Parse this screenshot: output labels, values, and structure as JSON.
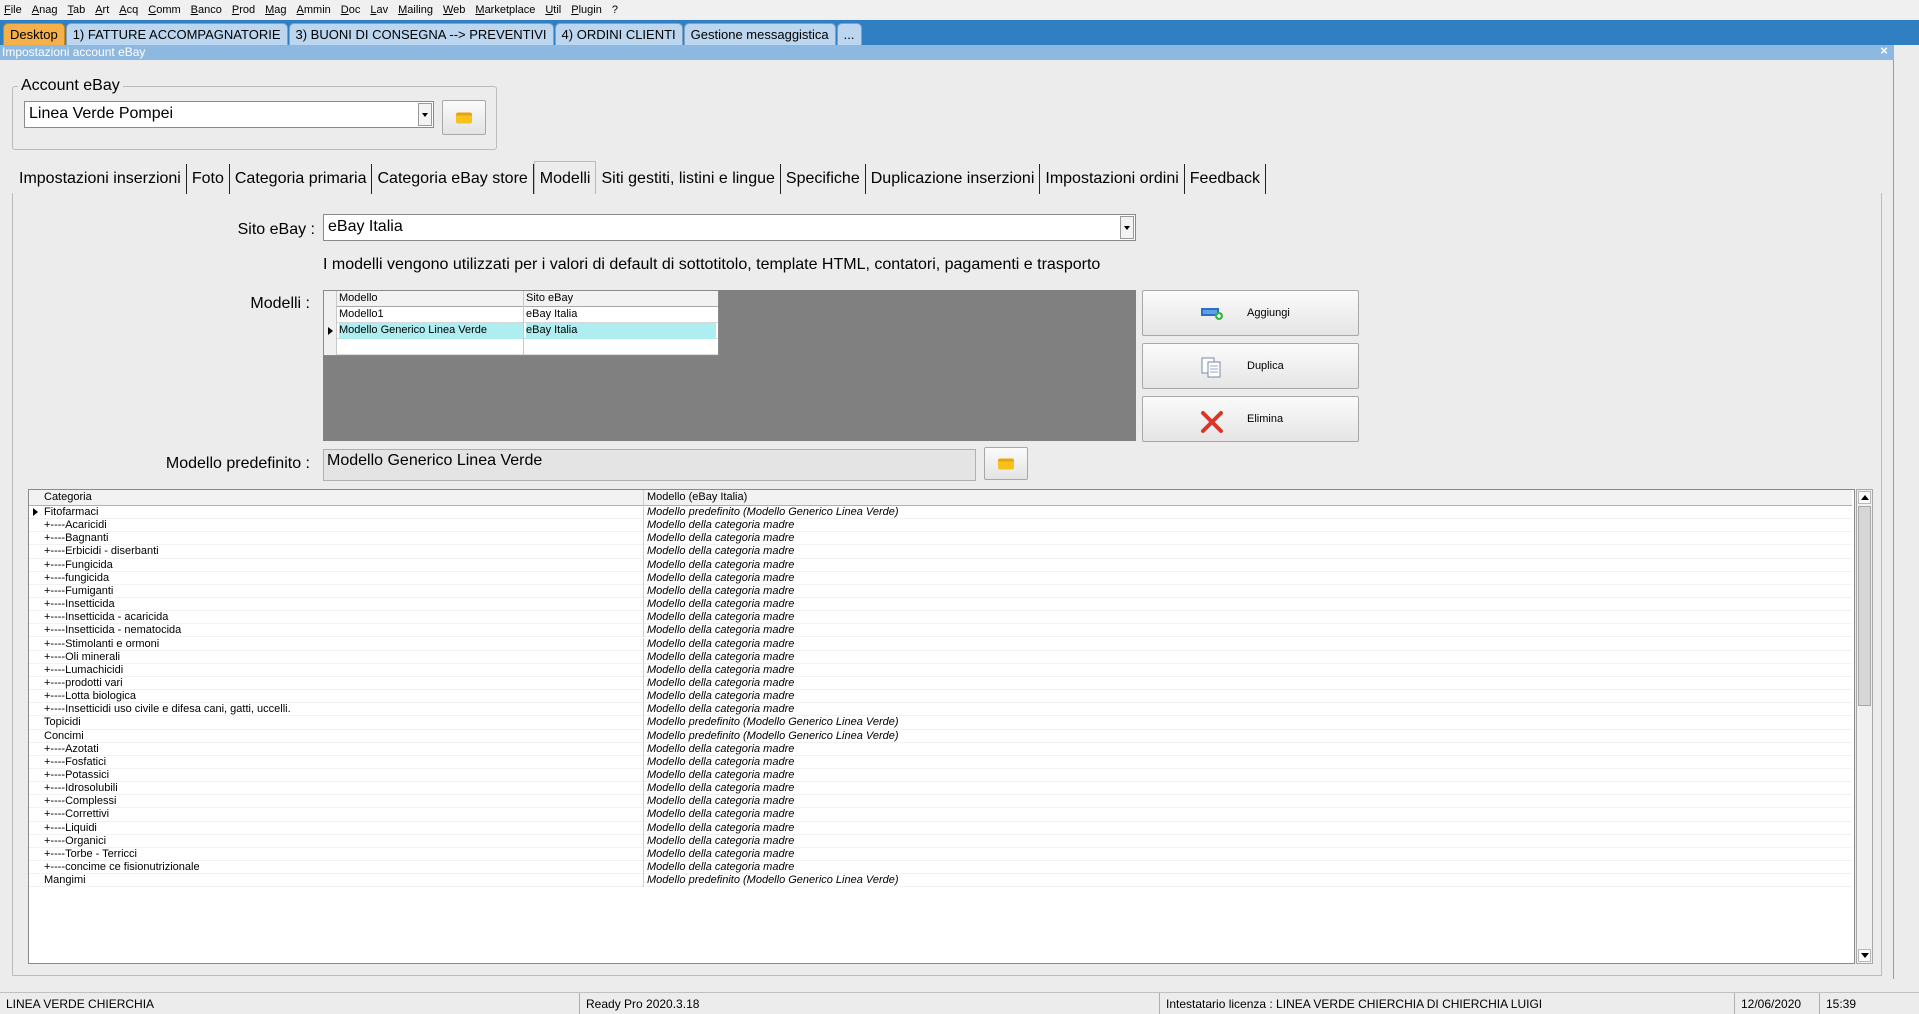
{
  "menu": [
    "File",
    "Anag",
    "Tab",
    "Art",
    "Acq",
    "Comm",
    "Banco",
    "Prod",
    "Mag",
    "Ammin",
    "Doc",
    "Lav",
    "Mailing",
    "Web",
    "Marketplace",
    "Util",
    "Plugin",
    "?"
  ],
  "desktop_tabs": [
    "Desktop",
    "1) FATTURE ACCOMPAGNATORIE",
    "3) BUONI DI CONSEGNA --> PREVENTIVI",
    "4) ORDINI CLIENTI",
    "Gestione messaggistica",
    "..."
  ],
  "window": {
    "title": "Impostazioni account eBay",
    "close": "×"
  },
  "account": {
    "group_title": "Account eBay",
    "value": "Linea Verde Pompei"
  },
  "page_tabs": [
    "Impostazioni inserzioni",
    "Foto",
    "Categoria primaria",
    "Categoria eBay store",
    "Modelli",
    "Siti gestiti, listini e lingue",
    "Specifiche",
    "Duplicazione inserzioni",
    "Impostazioni ordini",
    "Feedback"
  ],
  "sito": {
    "label": "Sito eBay :",
    "value": "eBay Italia"
  },
  "info_text": "I modelli vengono utilizzati per i valori di default di sottotitolo, template HTML, contatori, pagamenti e trasporto",
  "modelli": {
    "label": "Modelli :",
    "headers": [
      "Modello",
      "Sito eBay"
    ],
    "rows": [
      [
        "Modello1",
        "eBay Italia"
      ],
      [
        "Modello Generico Linea Verde",
        "eBay Italia"
      ]
    ]
  },
  "actions": {
    "add": "Aggiungi",
    "duplicate": "Duplica",
    "delete": "Elimina"
  },
  "predefinito": {
    "label": "Modello predefinito :",
    "value": "Modello Generico Linea Verde"
  },
  "categorie": {
    "headers": [
      "Categoria",
      "Modello (eBay Italia)"
    ],
    "rows": [
      [
        "Fitofarmaci",
        "Modello predefinito (Modello Generico Linea Verde)"
      ],
      [
        "+----Acaricidi",
        "Modello della categoria madre"
      ],
      [
        "+----Bagnanti",
        "Modello della categoria madre"
      ],
      [
        "+----Erbicidi - diserbanti",
        "Modello della categoria madre"
      ],
      [
        "+----Fungicida",
        "Modello della categoria madre"
      ],
      [
        "+----fungicida",
        "Modello della categoria madre"
      ],
      [
        "+----Fumiganti",
        "Modello della categoria madre"
      ],
      [
        "+----Insetticida",
        "Modello della categoria madre"
      ],
      [
        "+----Insetticida - acaricida",
        "Modello della categoria madre"
      ],
      [
        "+----Insetticida - nematocida",
        "Modello della categoria madre"
      ],
      [
        "+----Stimolanti e ormoni",
        "Modello della categoria madre"
      ],
      [
        "+----Oli minerali",
        "Modello della categoria madre"
      ],
      [
        "+----Lumachicidi",
        "Modello della categoria madre"
      ],
      [
        "+----prodotti vari",
        "Modello della categoria madre"
      ],
      [
        "+----Lotta biologica",
        "Modello della categoria madre"
      ],
      [
        "+----Insetticidi uso civile e difesa cani, gatti, uccelli.",
        "Modello della categoria madre"
      ],
      [
        "Topicidi",
        "Modello predefinito (Modello Generico Linea Verde)"
      ],
      [
        "Concimi",
        "Modello predefinito (Modello Generico Linea Verde)"
      ],
      [
        "+----Azotati",
        "Modello della categoria madre"
      ],
      [
        "+----Fosfatici",
        "Modello della categoria madre"
      ],
      [
        "+----Potassici",
        "Modello della categoria madre"
      ],
      [
        "+----Idrosolubili",
        "Modello della categoria madre"
      ],
      [
        "+----Complessi",
        "Modello della categoria madre"
      ],
      [
        "+----Correttivi",
        "Modello della categoria madre"
      ],
      [
        "+----Liquidi",
        "Modello della categoria madre"
      ],
      [
        "+----Organici",
        "Modello della categoria madre"
      ],
      [
        "+----Torbe - Terricci",
        "Modello della categoria madre"
      ],
      [
        "+----concime ce fisionutrizionale",
        "Modello della categoria madre"
      ],
      [
        "Mangimi",
        "Modello predefinito (Modello Generico Linea Verde)"
      ]
    ]
  },
  "status": {
    "company": "LINEA VERDE CHIERCHIA",
    "version": "Ready Pro 2020.3.18",
    "license": "Intestatario licenza : LINEA VERDE CHIERCHIA DI CHIERCHIA LUIGI",
    "date": "12/06/2020",
    "time": "15:39"
  },
  "colors": {
    "selected_row": "#aeeef0",
    "active_desktop_tab": "#f6b04a",
    "tabbar": "#2f7fc2"
  }
}
